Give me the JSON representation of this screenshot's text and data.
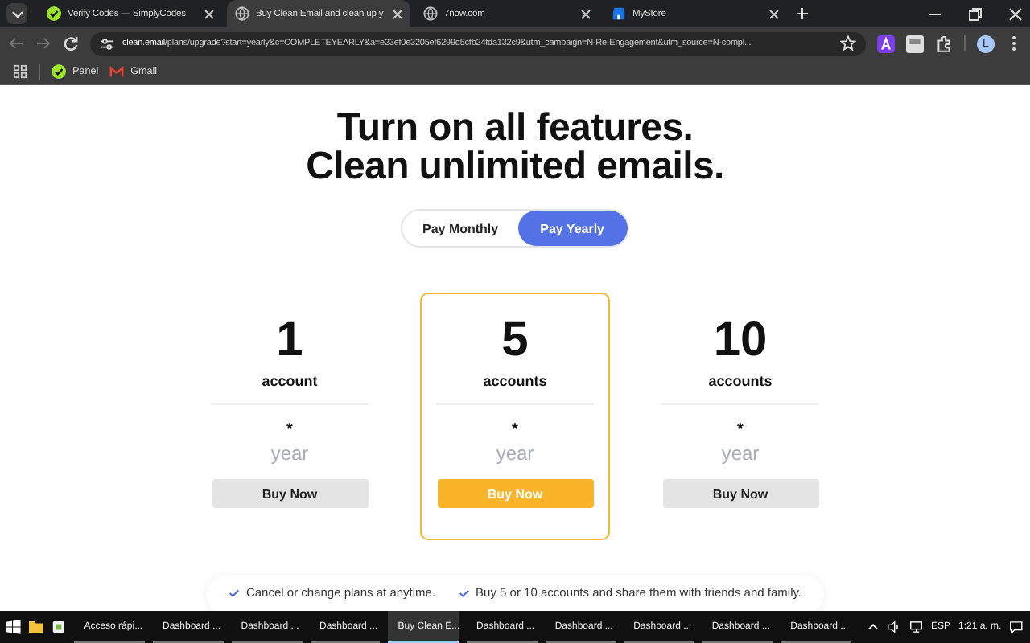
{
  "browser": {
    "tabs": [
      {
        "title": "Verify Codes — SimplyCodes",
        "selected": false
      },
      {
        "title": "Buy Clean Email and clean up y",
        "selected": true
      },
      {
        "title": "7now.com",
        "selected": false
      },
      {
        "title": "MyStore",
        "selected": false
      }
    ],
    "url_host": "clean.email",
    "url_path": "/plans/upgrade?start=yearly&c=COMPLETEYEARLY&a=e23ef0e3205ef6299d5cfb24fda132c9&utm_campaign=N-Re-Engagement&utm_source=N-compl...",
    "profile_initial": "L",
    "bookmarks": [
      "Panel",
      "Gmail"
    ]
  },
  "page": {
    "heading": [
      "Turn on all features.",
      "Clean unlimited emails."
    ],
    "billing": [
      {
        "label": "Pay Monthly",
        "selected": false
      },
      {
        "label": "Pay Yearly",
        "selected": true
      }
    ],
    "plans": [
      {
        "count": "1",
        "unit": "account",
        "price": "*",
        "period": "year",
        "button": "Buy Now",
        "highlighted": false
      },
      {
        "count": "5",
        "unit": "accounts",
        "price": "*",
        "period": "year",
        "button": "Buy Now",
        "highlighted": true
      },
      {
        "count": "10",
        "unit": "accounts",
        "price": "*",
        "period": "year",
        "button": "Buy Now",
        "highlighted": false
      }
    ],
    "features": [
      "Cancel or change plans at anytime.",
      "Buy 5 or 10 accounts and share them with friends and family."
    ]
  },
  "taskbar": {
    "items": [
      {
        "label": "Acceso rápi...",
        "selected": false
      },
      {
        "label": "Dashboard ...",
        "selected": false
      },
      {
        "label": "Dashboard ...",
        "selected": false
      },
      {
        "label": "Dashboard ...",
        "selected": false
      },
      {
        "label": "Buy Clean E...",
        "selected": true
      },
      {
        "label": "Dashboard ...",
        "selected": false
      },
      {
        "label": "Dashboard ...",
        "selected": false
      },
      {
        "label": "Dashboard ...",
        "selected": false
      },
      {
        "label": "Dashboard ...",
        "selected": false
      },
      {
        "label": "Dashboard ...",
        "selected": false
      }
    ],
    "language": "ESP",
    "time": "1:21 a. m."
  }
}
